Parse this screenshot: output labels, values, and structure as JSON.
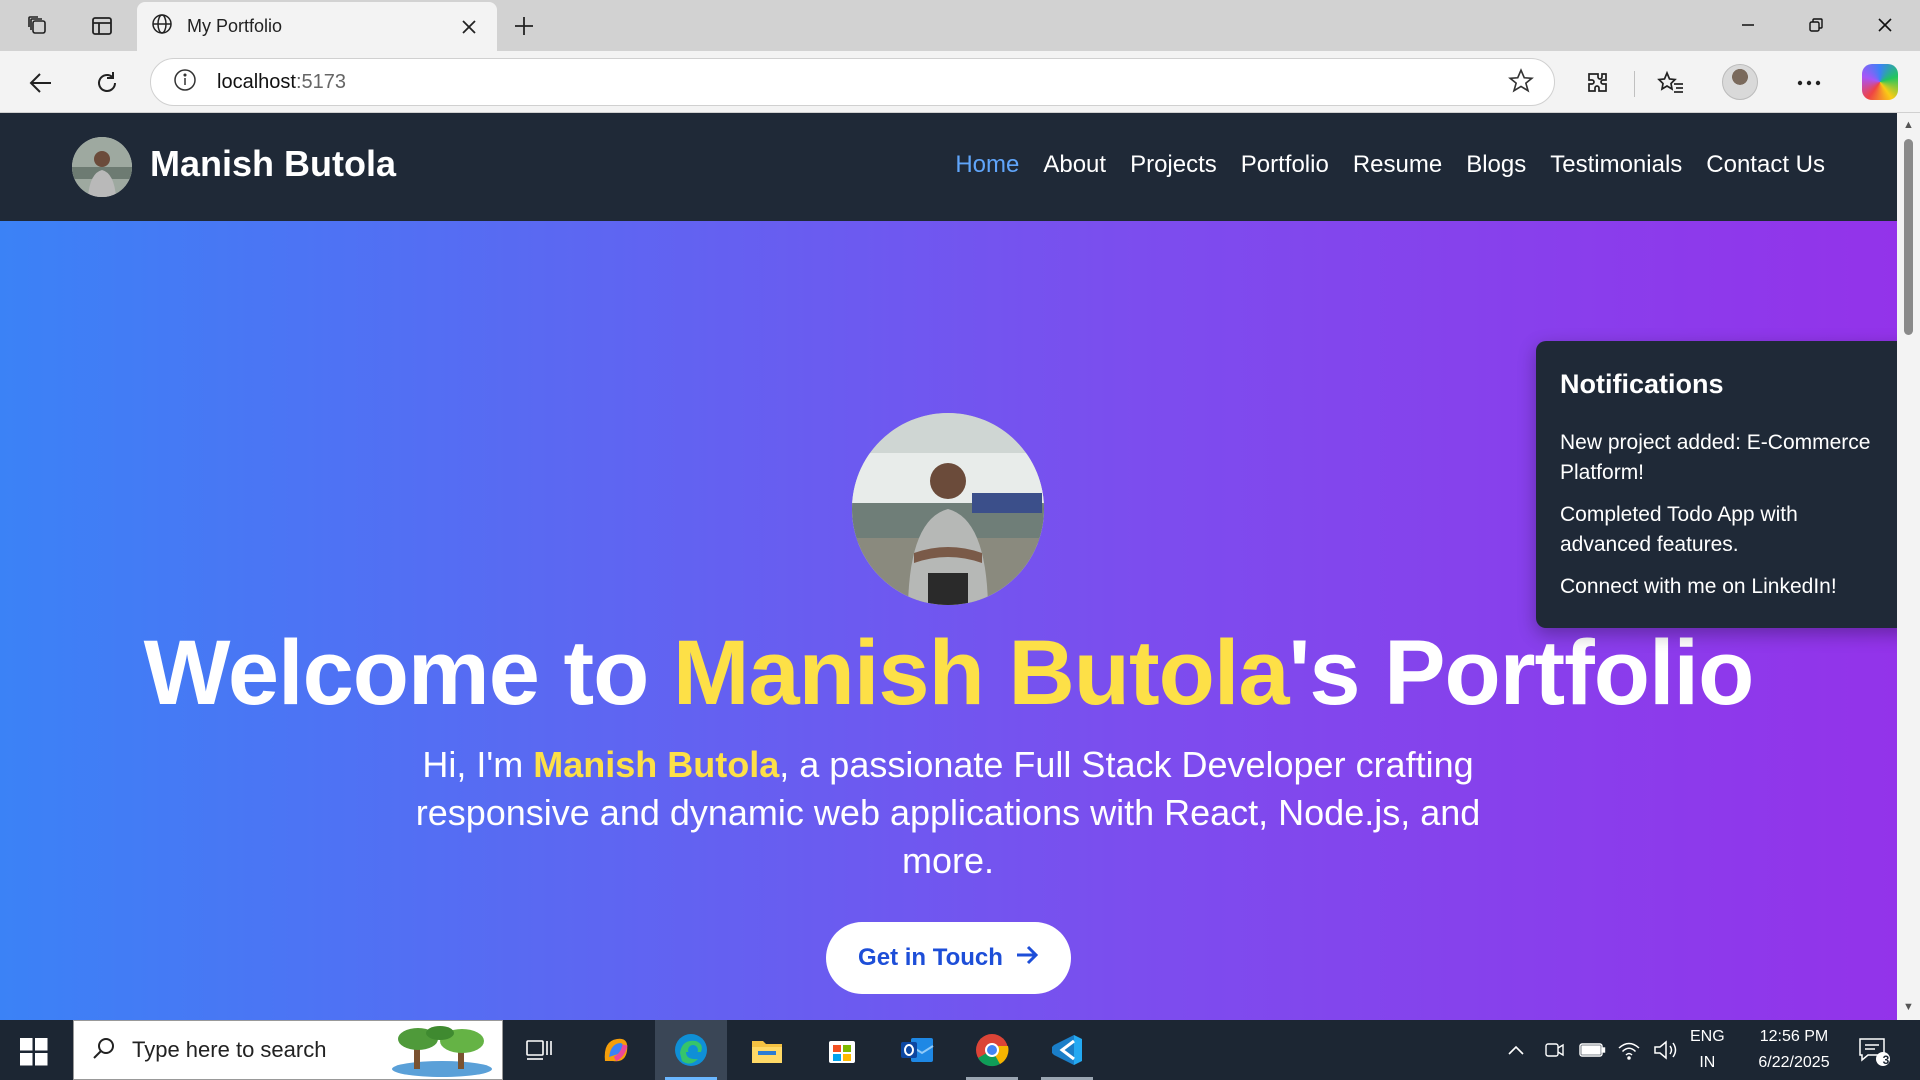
{
  "browser": {
    "tab_title": "My Portfolio",
    "url_host": "localhost",
    "url_port": ":5173"
  },
  "site": {
    "brand": "Manish Butola",
    "nav": [
      {
        "label": "Home",
        "active": true
      },
      {
        "label": "About"
      },
      {
        "label": "Projects"
      },
      {
        "label": "Portfolio"
      },
      {
        "label": "Resume"
      },
      {
        "label": "Blogs"
      },
      {
        "label": "Testimonials"
      },
      {
        "label": "Contact Us"
      }
    ],
    "hero": {
      "title_pre": "Welcome to ",
      "title_name": "Manish Butola",
      "title_post": "'s Portfolio",
      "sub_pre": "Hi, I'm ",
      "sub_name": "Manish Butola",
      "sub_post": ", a passionate Full Stack Developer crafting responsive and dynamic web applications with React, Node.js, and more.",
      "cta_label": "Get in Touch"
    },
    "notifications": {
      "title": "Notifications",
      "items": [
        "New project added: E-Commerce Platform!",
        "Completed Todo App with advanced features.",
        "Connect with me on LinkedIn!"
      ]
    },
    "colors": {
      "nav_bg": "#1f2937",
      "accent_yellow": "#fde047",
      "active_link": "#60a5fa",
      "gradient_start": "#3b82f6",
      "gradient_end": "#9333ea"
    }
  },
  "taskbar": {
    "search_placeholder": "Type here to search",
    "lang_top": "ENG",
    "lang_bottom": "IN",
    "time": "12:56 PM",
    "date": "6/22/2025",
    "notification_count": "3"
  }
}
